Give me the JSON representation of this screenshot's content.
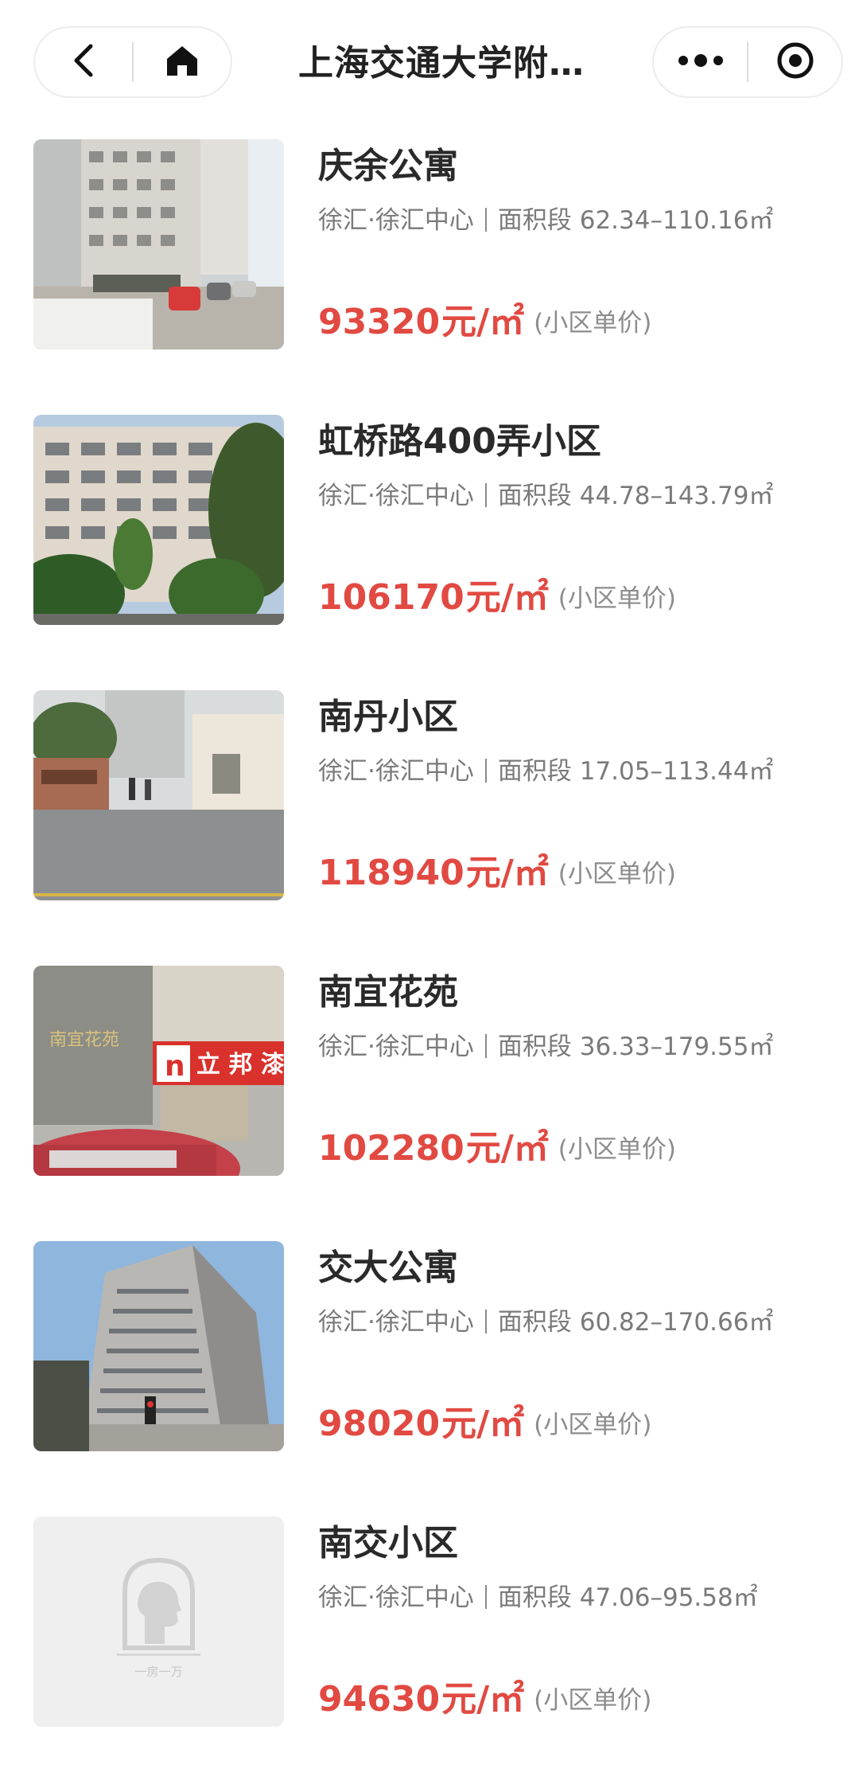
{
  "header": {
    "title": "上海交通大学附…",
    "back_icon": "back-chevron-icon",
    "home_icon": "home-icon",
    "more_icon": "more-dots-icon",
    "close_icon": "target-close-icon"
  },
  "colors": {
    "price": "#e14a42",
    "text_primary": "#2a2a2a",
    "text_secondary": "#7a7a7a"
  },
  "listings": [
    {
      "name": "庆余公寓",
      "location": "徐汇·徐汇中心",
      "area_label": "面积段",
      "area_range": "62.34–110.16㎡",
      "price": "93320",
      "price_unit": "元/㎡",
      "price_note": "(小区单价)"
    },
    {
      "name": "虹桥路400弄小区",
      "location": "徐汇·徐汇中心",
      "area_label": "面积段",
      "area_range": "44.78–143.79㎡",
      "price": "106170",
      "price_unit": "元/㎡",
      "price_note": "(小区单价)"
    },
    {
      "name": "南丹小区",
      "location": "徐汇·徐汇中心",
      "area_label": "面积段",
      "area_range": "17.05–113.44㎡",
      "price": "118940",
      "price_unit": "元/㎡",
      "price_note": "(小区单价)"
    },
    {
      "name": "南宜花苑",
      "location": "徐汇·徐汇中心",
      "area_label": "面积段",
      "area_range": "36.33–179.55㎡",
      "price": "102280",
      "price_unit": "元/㎡",
      "price_note": "(小区单价)",
      "photo_sign_text": "立 邦 漆",
      "photo_sign_logo": "n",
      "photo_gate_text": "南宜花苑"
    },
    {
      "name": "交大公寓",
      "location": "徐汇·徐汇中心",
      "area_label": "面积段",
      "area_range": "60.82–170.66㎡",
      "price": "98020",
      "price_unit": "元/㎡",
      "price_note": "(小区单价)"
    },
    {
      "name": "南交小区",
      "location": "徐汇·徐汇中心",
      "area_label": "面积段",
      "area_range": "47.06–95.58㎡",
      "price": "94630",
      "price_unit": "元/㎡",
      "price_note": "(小区单价)",
      "placeholder_caption": "一房一万"
    }
  ]
}
